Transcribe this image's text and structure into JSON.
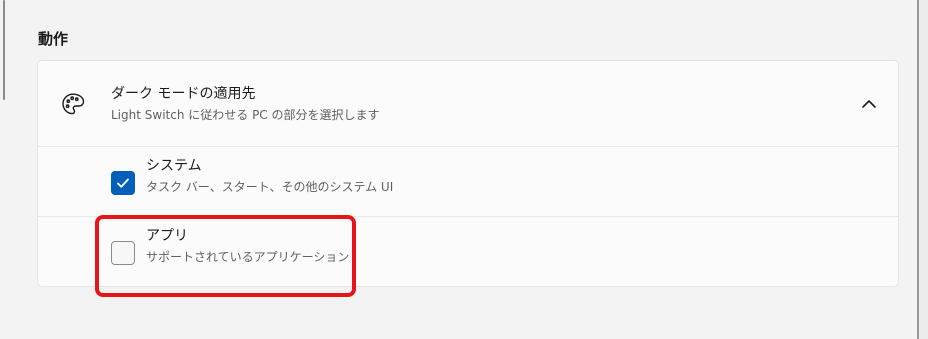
{
  "section": {
    "title": "動作"
  },
  "dark_mode_target": {
    "icon": "palette-icon",
    "title": "ダーク モードの適用先",
    "subtitle": "Light Switch に従わせる PC の部分を選択します",
    "expanded": true,
    "toggle_icon": "chevron-up-icon"
  },
  "options": [
    {
      "label": "システム",
      "description": "タスク バー、スタート、その他のシステム UI",
      "checked": true
    },
    {
      "label": "アプリ",
      "description": "サポートされているアプリケーション",
      "checked": false
    }
  ],
  "colors": {
    "accent": "#005fb8",
    "highlight": "#e8141c",
    "background": "#f3f3f3",
    "card": "#fbfbfb"
  }
}
